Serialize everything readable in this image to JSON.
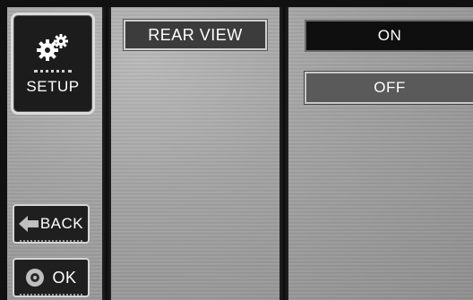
{
  "sidebar": {
    "setup_label": "SETUP",
    "setup_icon": "gears-icon",
    "back_label": "BACK",
    "back_icon": "arrow-left-icon",
    "ok_label": "OK",
    "ok_icon": "disc-icon"
  },
  "menu": {
    "item_label": "REAR VIEW"
  },
  "options": {
    "on_label": "ON",
    "off_label": "OFF",
    "selected": "ON"
  },
  "colors": {
    "selected_option": "#0f0f0f",
    "unselected_option": "#5a5a5a",
    "panel_texture": "#a2a2a2"
  }
}
